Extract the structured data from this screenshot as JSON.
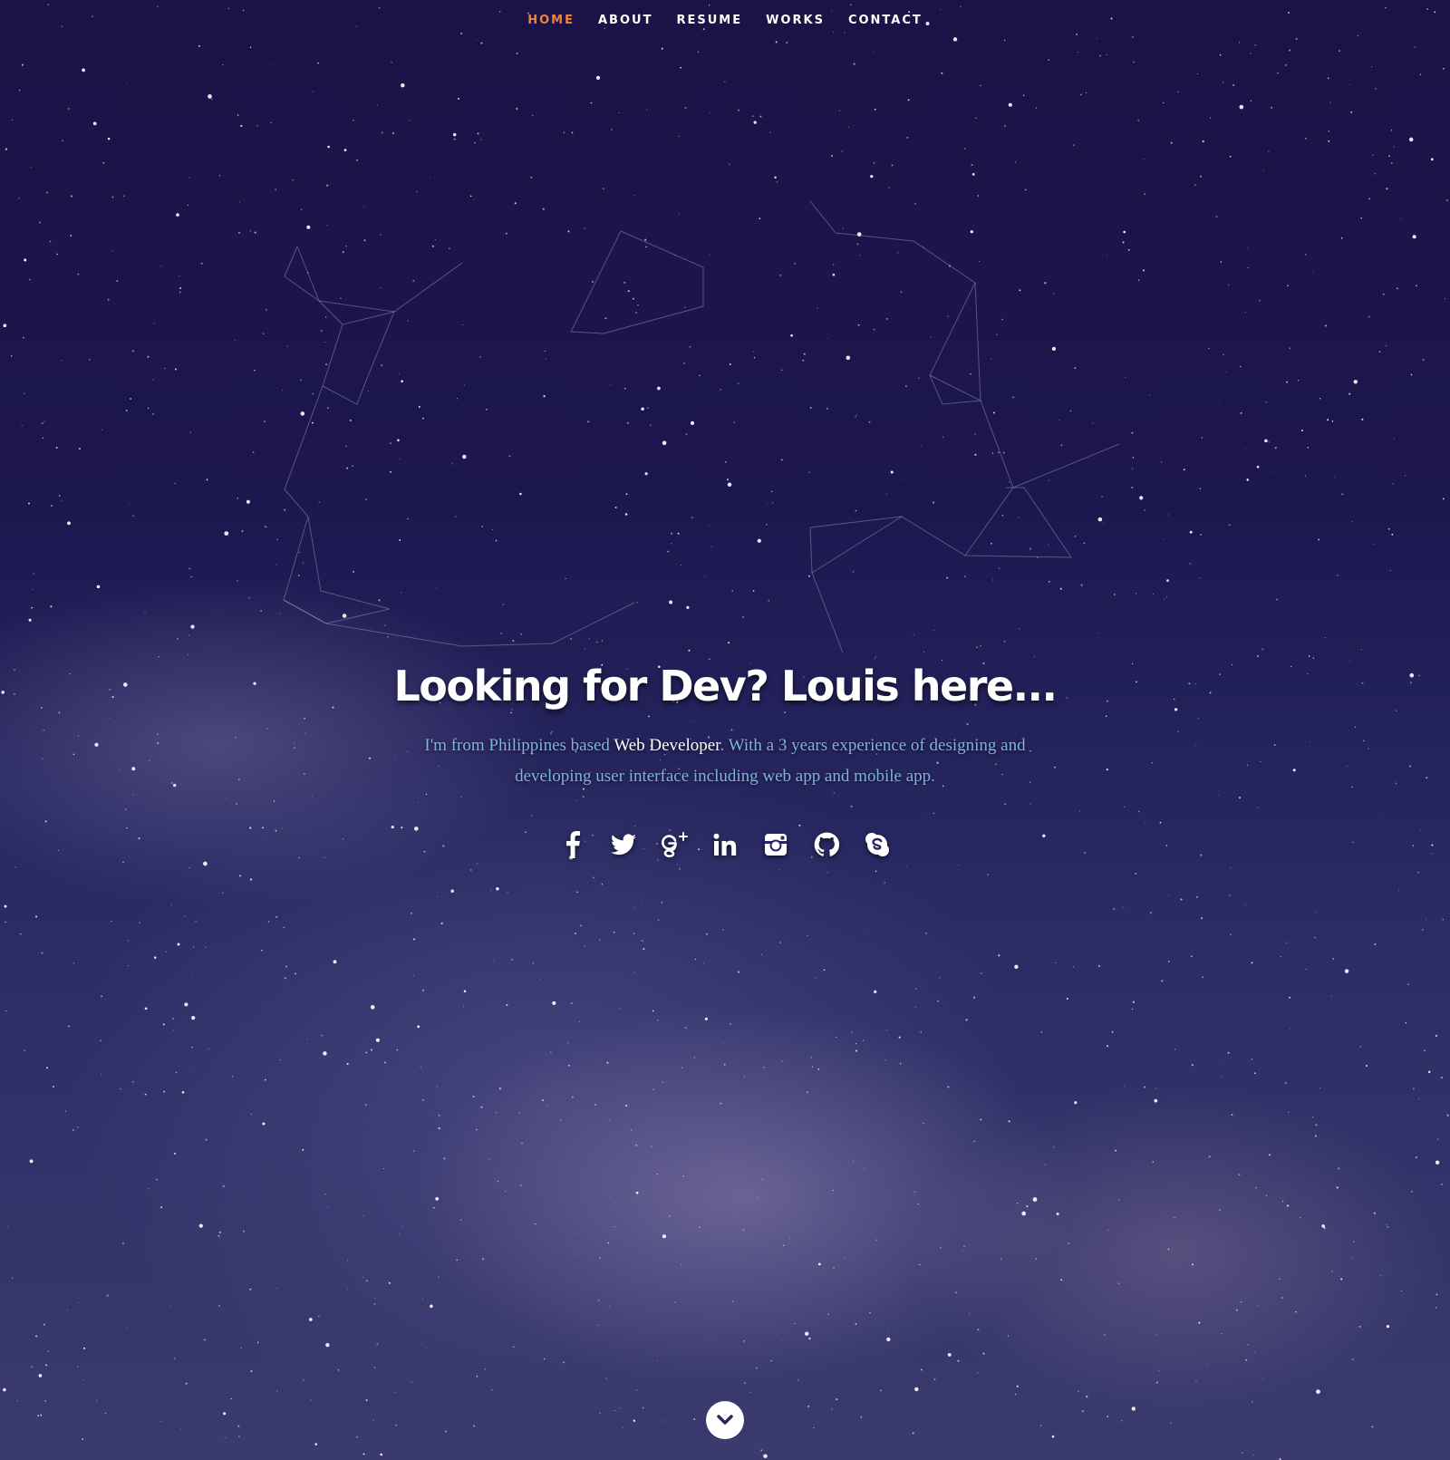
{
  "nav": {
    "items": [
      {
        "label": "HOME",
        "active": true
      },
      {
        "label": "ABOUT",
        "active": false
      },
      {
        "label": "RESUME",
        "active": false
      },
      {
        "label": "WORKS",
        "active": false
      },
      {
        "label": "CONTACT",
        "active": false
      }
    ]
  },
  "hero": {
    "title": "Looking for Dev? Louis here...",
    "intro_part1": "I'm from Philippines based ",
    "intro_highlight": "Web Developer",
    "intro_part2": ". With a 3 years experience of designing and developing user interface including web app and mobile app."
  },
  "social": [
    {
      "icon": "facebook-icon"
    },
    {
      "icon": "twitter-icon"
    },
    {
      "icon": "google-plus-icon"
    },
    {
      "icon": "linkedin-icon"
    },
    {
      "icon": "instagram-icon"
    },
    {
      "icon": "github-icon"
    },
    {
      "icon": "skype-icon"
    }
  ],
  "scroll_down": {
    "icon": "chevron-down-icon"
  },
  "colors": {
    "accent": "#f0823a",
    "intro_text": "#7fb3e0",
    "title": "#ffffff",
    "background": "#1d1750"
  }
}
